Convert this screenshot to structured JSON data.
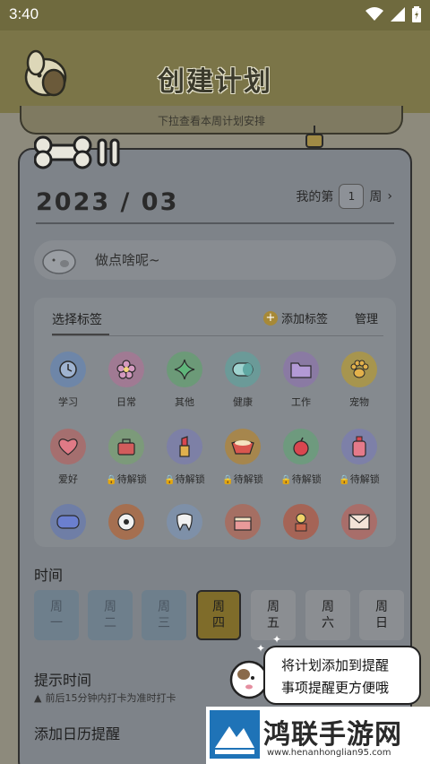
{
  "status_bar": {
    "time": "3:40"
  },
  "header": {
    "title": "创建计划",
    "pull_hint": "下拉查看本周计划安排"
  },
  "plan": {
    "year_month": "2023 / 03",
    "week_prefix": "我的第",
    "week_number": "1",
    "week_suffix": "周"
  },
  "task_input": {
    "placeholder": "做点啥呢~"
  },
  "tags": {
    "title": "选择标签",
    "add_label": "添加标签",
    "manage_label": "管理",
    "items": [
      {
        "label": "学习",
        "icon": "clock-icon",
        "color": "#6e86a8"
      },
      {
        "label": "日常",
        "icon": "flower-icon",
        "color": "#a07a93"
      },
      {
        "label": "其他",
        "icon": "sparkle-icon",
        "color": "#6c9a78"
      },
      {
        "label": "健康",
        "icon": "pill-icon",
        "color": "#6b9a98"
      },
      {
        "label": "工作",
        "icon": "folder-icon",
        "color": "#8a7aa3"
      },
      {
        "label": "宠物",
        "icon": "paw-icon",
        "color": "#a7954e"
      },
      {
        "label": "爱好",
        "icon": "heart-icon",
        "color": "#a56f6f"
      },
      {
        "label": "待解锁",
        "icon": "bag-icon",
        "color": "#7c9a7a"
      },
      {
        "label": "待解锁",
        "icon": "lipstick-icon",
        "color": "#7d80a6"
      },
      {
        "label": "待解锁",
        "icon": "bowl-icon",
        "color": "#a6864d"
      },
      {
        "label": "待解锁",
        "icon": "apple-icon",
        "color": "#6e9a7e"
      },
      {
        "label": "待解锁",
        "icon": "bottle-icon",
        "color": "#7d80a8"
      },
      {
        "label": "",
        "icon": "game-icon",
        "color": "#6f7ea6"
      },
      {
        "label": "",
        "icon": "ball-icon",
        "color": "#a56f50"
      },
      {
        "label": "",
        "icon": "tooth-icon",
        "color": "#7e90a8"
      },
      {
        "label": "",
        "icon": "cake-icon",
        "color": "#a56f63"
      },
      {
        "label": "",
        "icon": "flower-pot-icon",
        "color": "#a56456"
      },
      {
        "label": "",
        "icon": "letter-icon",
        "color": "#a86e6a"
      }
    ]
  },
  "time_section": {
    "label": "时间",
    "days": [
      {
        "top": "周",
        "bottom": "一",
        "state": "past"
      },
      {
        "top": "周",
        "bottom": "二",
        "state": "past"
      },
      {
        "top": "周",
        "bottom": "三",
        "state": "past"
      },
      {
        "top": "周",
        "bottom": "四",
        "state": "today"
      },
      {
        "top": "周",
        "bottom": "五",
        "state": "future"
      },
      {
        "top": "周",
        "bottom": "六",
        "state": "future"
      },
      {
        "top": "周",
        "bottom": "日",
        "state": "future"
      }
    ]
  },
  "remind": {
    "label": "提示时间",
    "note": "前后15分钟内打卡为准时打卡"
  },
  "calendar": {
    "label": "添加日历提醒"
  },
  "tooltip": {
    "line1": "将计划添加到提醒",
    "line2": "事项提醒更方便哦"
  },
  "watermark": {
    "name": "鸿联手游网",
    "url": "www.henanhonglian95.com"
  }
}
